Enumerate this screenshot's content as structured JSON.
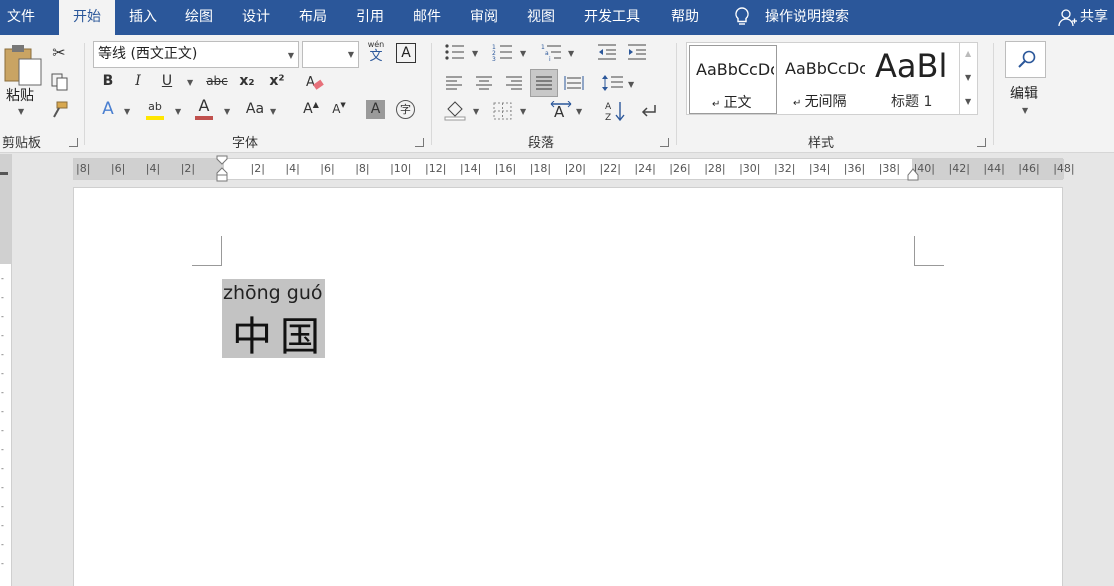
{
  "tabs": {
    "file": "文件",
    "home": "开始",
    "insert": "插入",
    "draw": "绘图",
    "design": "设计",
    "layout": "布局",
    "references": "引用",
    "mailings": "邮件",
    "review": "审阅",
    "view": "视图",
    "developer": "开发工具",
    "help": "帮助",
    "tell_me": "操作说明搜索",
    "share": "共享"
  },
  "clipboard": {
    "paste_label": "粘贴",
    "group_label": "剪贴板"
  },
  "font": {
    "font_name": "等线 (西文正文)",
    "font_size": "",
    "phonetic_top": "wén",
    "phonetic_bottom": "文",
    "border_char": "A",
    "bold": "B",
    "italic": "I",
    "underline": "U",
    "strike": "abc",
    "subscript": "x₂",
    "superscript": "x²",
    "text_effects": "A",
    "highlight": "ab",
    "font_color": "A",
    "change_case": "Aa",
    "grow": "A",
    "shrink": "A",
    "shading": "A",
    "enclose": "字",
    "group_label": "字体",
    "highlight_color": "#ffe600",
    "font_color_bar": "#c0504d"
  },
  "paragraph": {
    "group_label": "段落"
  },
  "styles": {
    "normal_preview": "AaBbCcDc",
    "normal_name": "正文",
    "nospacing_preview": "AaBbCcDc",
    "nospacing_name": "无间隔",
    "heading1_preview": "AaBl",
    "heading1_name": "标题 1",
    "group_label": "样式"
  },
  "editing": {
    "label": "编辑"
  },
  "ruler": {
    "numbers": [
      "8",
      "6",
      "4",
      "2",
      "2",
      "4",
      "6",
      "8",
      "10",
      "12",
      "14",
      "16",
      "18",
      "20",
      "22",
      "24",
      "26",
      "28",
      "30",
      "32",
      "34",
      "36",
      "38",
      "40",
      "42",
      "44",
      "46",
      "48"
    ]
  },
  "document": {
    "pinyin": "zhōng guó",
    "hanzi": "中国"
  },
  "colors": {
    "accent": "#2b579a",
    "selection": "#c3c3c3"
  }
}
